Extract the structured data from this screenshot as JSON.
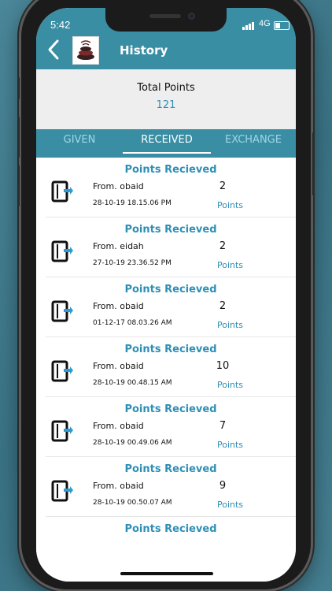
{
  "status": {
    "time": "5:42",
    "network": "4G"
  },
  "header": {
    "title": "History"
  },
  "summary": {
    "label": "Total Points",
    "value": "121"
  },
  "tabs": [
    {
      "label": "GIVEN",
      "active": false
    },
    {
      "label": "RECEIVED",
      "active": true
    },
    {
      "label": "EXCHANGE",
      "active": false
    }
  ],
  "items": [
    {
      "heading": "Points Recieved",
      "from": "From. obaid",
      "date": "28-10-19 18.15.06 PM",
      "points": "2",
      "unit": "Points"
    },
    {
      "heading": "Points Recieved",
      "from": "From. eidah",
      "date": "27-10-19 23.36.52 PM",
      "points": "2",
      "unit": "Points"
    },
    {
      "heading": "Points Recieved",
      "from": "From. obaid",
      "date": "01-12-17 08.03.26 AM",
      "points": "2",
      "unit": "Points"
    },
    {
      "heading": "Points Recieved",
      "from": "From. obaid",
      "date": "28-10-19 00.48.15 AM",
      "points": "10",
      "unit": "Points"
    },
    {
      "heading": "Points Recieved",
      "from": "From. obaid",
      "date": "28-10-19 00.49.06 AM",
      "points": "7",
      "unit": "Points"
    },
    {
      "heading": "Points Recieved",
      "from": "From. obaid",
      "date": "28-10-19 00.50.07 AM",
      "points": "9",
      "unit": "Points"
    },
    {
      "heading": "Points Recieved"
    }
  ],
  "colors": {
    "accent": "#3a8ea4",
    "link": "#2e8fb5",
    "background": "#3f7a8c"
  },
  "icons": {
    "back": "chevron-left-icon",
    "item": "receive-points-icon"
  }
}
